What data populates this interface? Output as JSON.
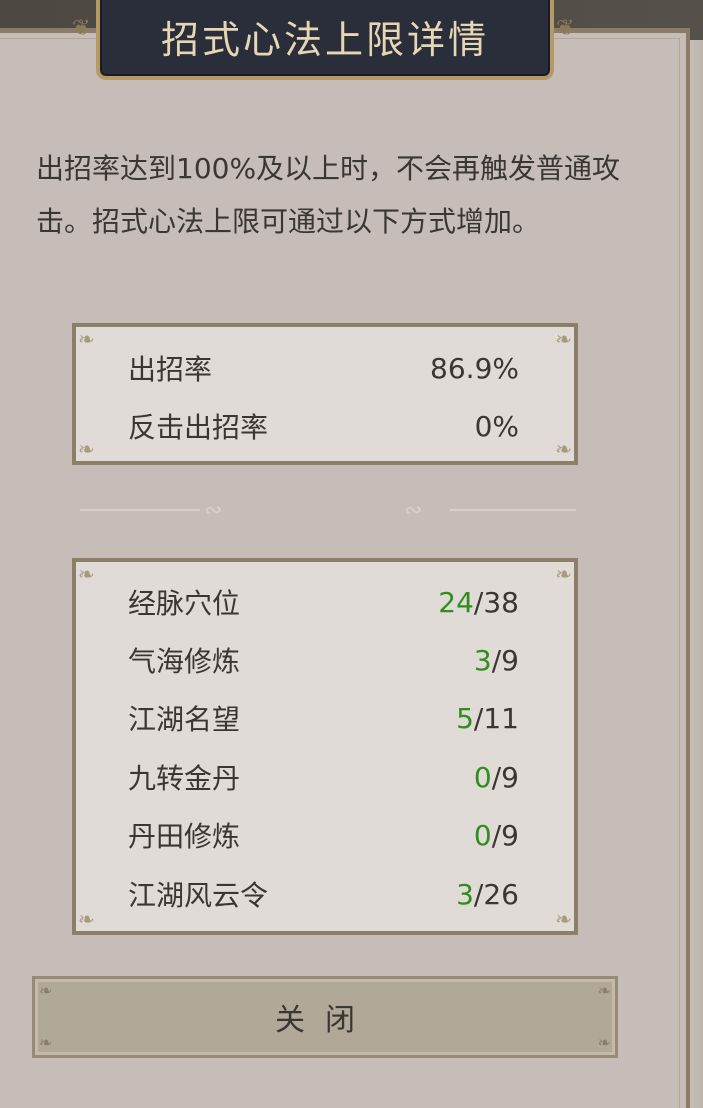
{
  "dialog": {
    "title": "招式心法上限详情",
    "intro": "出招率达到100%及以上时，不会再触发普通攻击。招式心法上限可通过以下方式增加。"
  },
  "rates": [
    {
      "label": "出招率",
      "value": "86.9%"
    },
    {
      "label": "反击出招率",
      "value": "0%"
    }
  ],
  "sources": [
    {
      "label": "经脉穴位",
      "current": "24",
      "sep": "/",
      "max": "38"
    },
    {
      "label": "气海修炼",
      "current": "3",
      "sep": "/",
      "max": "9"
    },
    {
      "label": "江湖名望",
      "current": "5",
      "sep": "/",
      "max": "11"
    },
    {
      "label": "九转金丹",
      "current": "0",
      "sep": "/",
      "max": "9"
    },
    {
      "label": "丹田修炼",
      "current": "0",
      "sep": "/",
      "max": "9"
    },
    {
      "label": "江湖风云令",
      "current": "3",
      "sep": "/",
      "max": "26"
    }
  ],
  "close_button": {
    "label": "关闭"
  },
  "colors": {
    "accent_green": "#2f8f1c",
    "title_bg": "#2a2d3a",
    "title_text": "#e6d6b4",
    "panel_bg": "#e0dbd7",
    "dialog_bg": "#c6bdb8"
  }
}
